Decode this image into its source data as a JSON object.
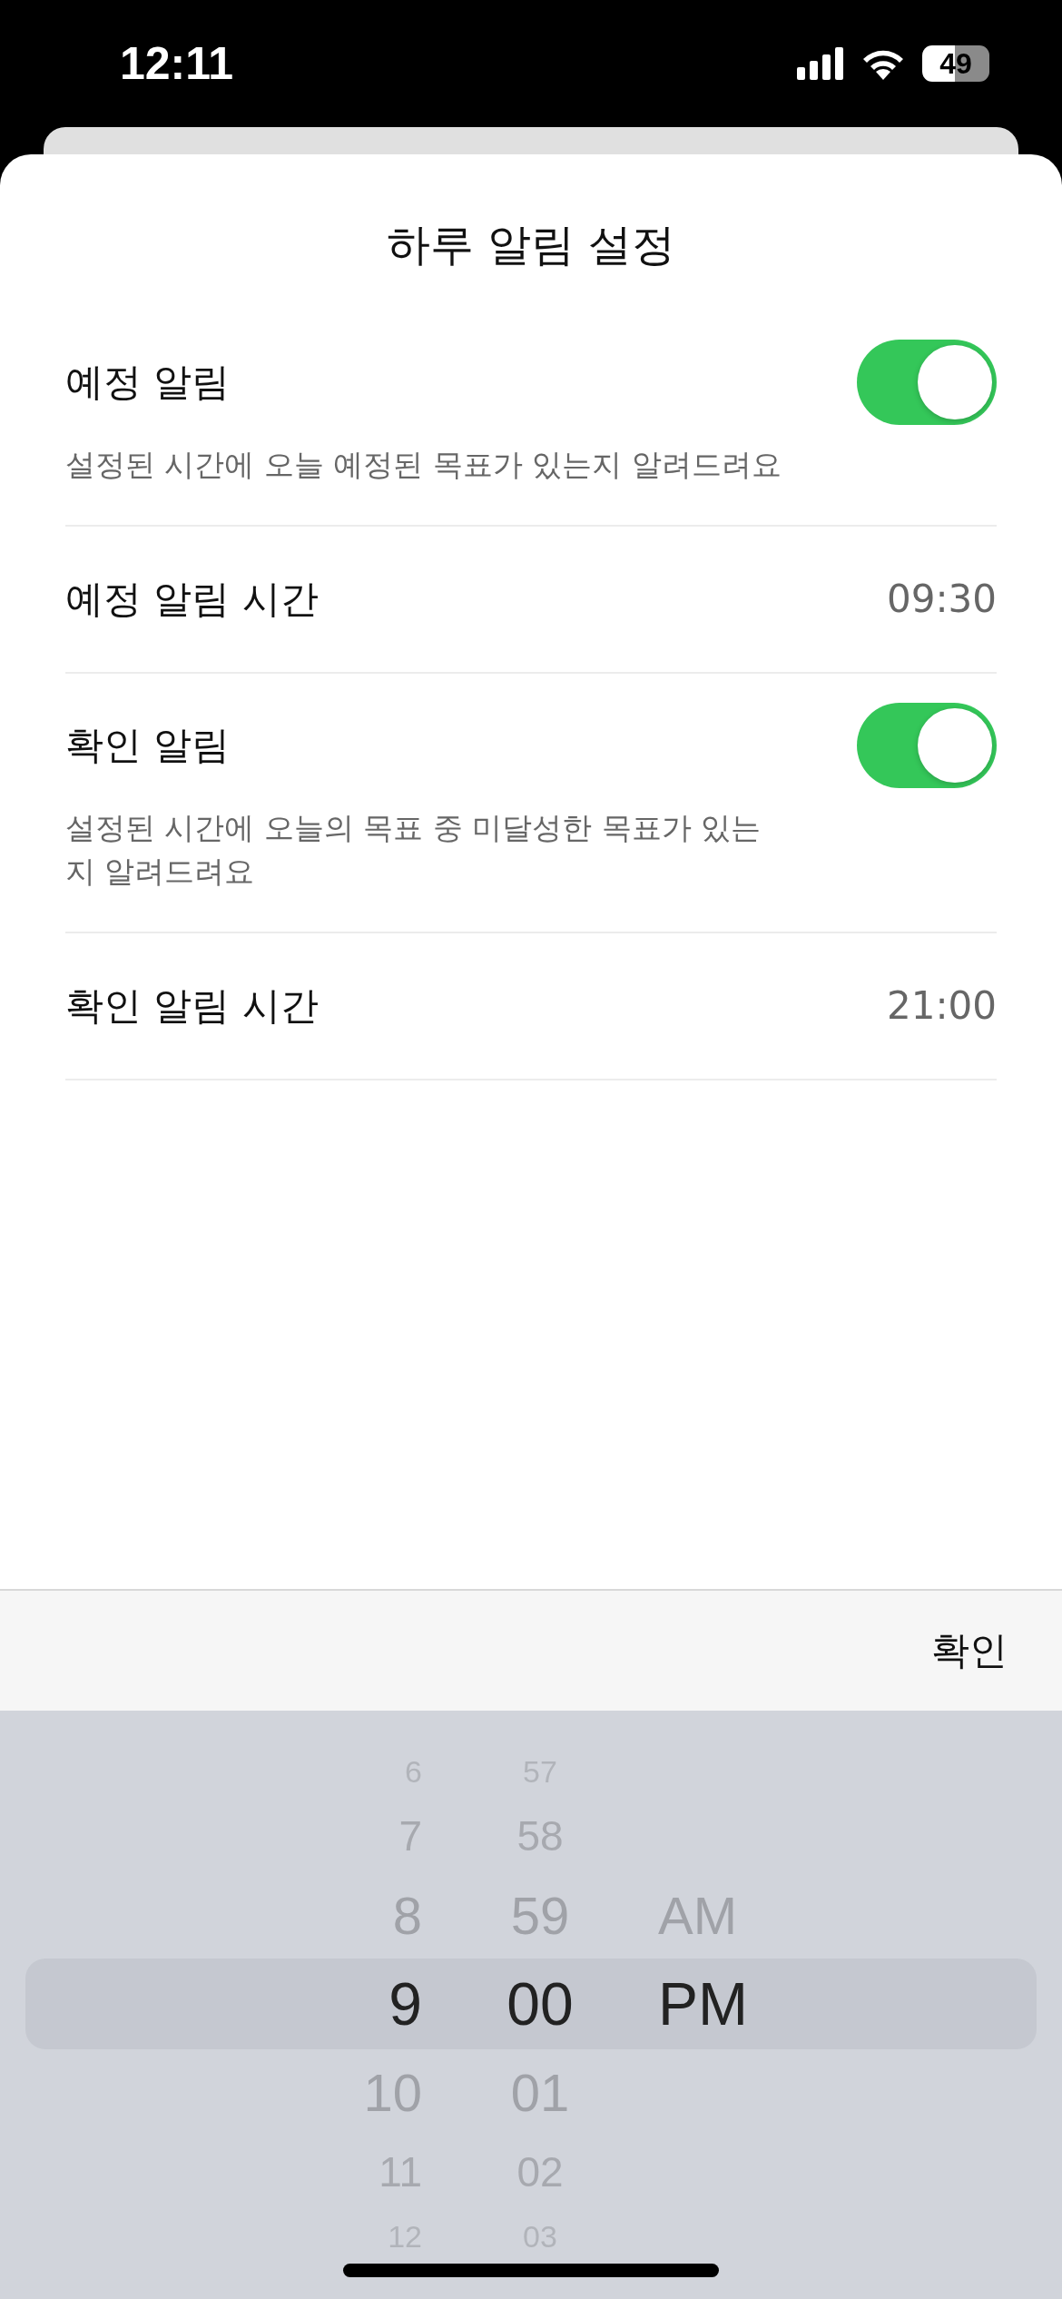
{
  "status_bar": {
    "time": "12:11",
    "battery": "49"
  },
  "sheet": {
    "title": "하루 알림 설정",
    "rows": [
      {
        "kind": "toggle",
        "label": "예정 알림",
        "description": "설정된 시간에 오늘 예정된 목표가 있는지 알려드려요",
        "on": true
      },
      {
        "kind": "time",
        "label": "예정 알림 시간",
        "value": "09:30"
      },
      {
        "kind": "toggle",
        "label": "확인 알림",
        "description": "설정된 시간에 오늘의 목표 중 미달성한 목표가 있는\n지 알려드려요",
        "on": true
      },
      {
        "kind": "time",
        "label": "확인 알림 시간",
        "value": "21:00"
      }
    ]
  },
  "toolbar": {
    "done": "확인"
  },
  "picker": {
    "columns": [
      {
        "items": [
          {
            "label": "6",
            "selected": false
          },
          {
            "label": "7",
            "selected": false
          },
          {
            "label": "8",
            "selected": false
          },
          {
            "label": "9",
            "selected": true
          },
          {
            "label": "10",
            "selected": false
          },
          {
            "label": "11",
            "selected": false
          },
          {
            "label": "12",
            "selected": false
          }
        ]
      },
      {
        "items": [
          {
            "label": "57",
            "selected": false
          },
          {
            "label": "58",
            "selected": false
          },
          {
            "label": "59",
            "selected": false
          },
          {
            "label": "00",
            "selected": true
          },
          {
            "label": "01",
            "selected": false
          },
          {
            "label": "02",
            "selected": false
          },
          {
            "label": "03",
            "selected": false
          }
        ]
      },
      {
        "items": [
          {
            "label": "AM",
            "selected": false
          },
          {
            "label": "PM",
            "selected": true
          }
        ]
      }
    ]
  }
}
